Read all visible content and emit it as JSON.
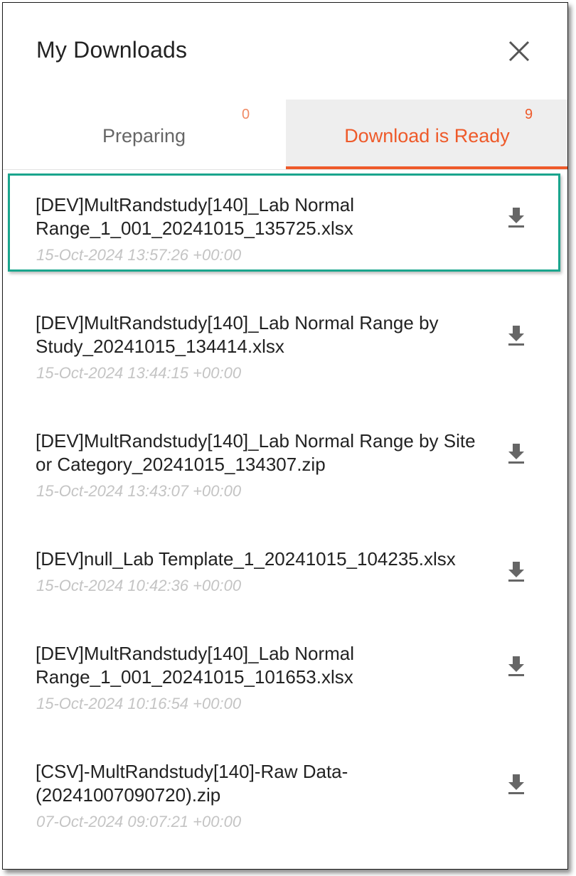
{
  "header": {
    "title": "My Downloads"
  },
  "icons": {
    "close": "close-icon",
    "download": "download-icon"
  },
  "colors": {
    "accent": "#ee5a2a",
    "selection": "#1aa58d",
    "date_text": "#c4c4c4"
  },
  "tabs": [
    {
      "label": "Preparing",
      "count": "0"
    },
    {
      "label": "Download is Ready",
      "count": "9",
      "active": true
    }
  ],
  "downloads": [
    {
      "name": "[DEV]MultRandstudy[140]_Lab Normal Range_1_001_20241015_135725.xlsx",
      "date": "15-Oct-2024 13:57:26 +00:00"
    },
    {
      "name": "[DEV]MultRandstudy[140]_Lab Normal Range by Study_20241015_134414.xlsx",
      "date": "15-Oct-2024 13:44:15 +00:00"
    },
    {
      "name": "[DEV]MultRandstudy[140]_Lab Normal Range by Site or Category_20241015_134307.zip",
      "date": "15-Oct-2024 13:43:07 +00:00"
    },
    {
      "name": "[DEV]null_Lab Template_1_20241015_104235.xlsx",
      "date": "15-Oct-2024 10:42:36 +00:00"
    },
    {
      "name": "[DEV]MultRandstudy[140]_Lab Normal Range_1_001_20241015_101653.xlsx",
      "date": "15-Oct-2024 10:16:54 +00:00"
    },
    {
      "name": "[CSV]-MultRandstudy[140]-Raw Data-(20241007090720).zip",
      "date": "07-Oct-2024 09:07:21 +00:00"
    }
  ]
}
